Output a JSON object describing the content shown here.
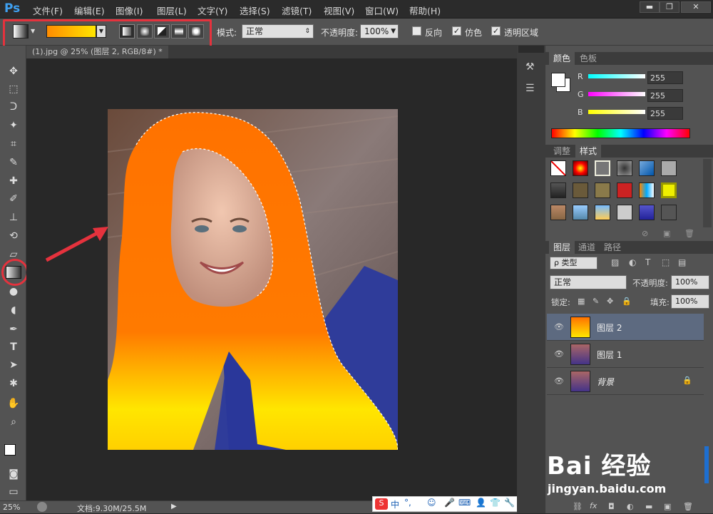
{
  "app": {
    "logo": "Ps"
  },
  "menu": [
    "文件(F)",
    "编辑(E)",
    "图像(I)",
    "图层(L)",
    "文字(Y)",
    "选择(S)",
    "滤镜(T)",
    "视图(V)",
    "窗口(W)",
    "帮助(H)"
  ],
  "window_controls": {
    "minimize": "▬",
    "restore": "❐",
    "close": "✕"
  },
  "options": {
    "mode_label": "模式:",
    "mode_value": "正常",
    "opacity_label": "不透明度:",
    "opacity_value": "100%",
    "reverse_label": "反向",
    "dither_label": "仿色",
    "transparency_label": "透明区域"
  },
  "document_tab": {
    "title": "(1).jpg @ 25% (图层 2, RGB/8#) *"
  },
  "status": {
    "zoom": "25%",
    "doc_info": "文档:9.30M/25.5M"
  },
  "color_panel": {
    "tabs": [
      "颜色",
      "色板"
    ],
    "channels": [
      {
        "label": "R",
        "value": "255",
        "color": "#00ffff"
      },
      {
        "label": "G",
        "value": "255",
        "color": "#ff00ff"
      },
      {
        "label": "B",
        "value": "255",
        "color": "#ffff00"
      }
    ]
  },
  "styles_panel": {
    "tabs": [
      "调整",
      "样式"
    ]
  },
  "layers_panel": {
    "tabs": [
      "图层",
      "通道",
      "路径"
    ],
    "filter_label": "ρ 类型",
    "blend_mode": "正常",
    "opacity_label": "不透明度:",
    "opacity_value": "100%",
    "lock_label": "锁定:",
    "fill_label": "填充:",
    "fill_value": "100%",
    "layers": [
      {
        "name": "图层 2",
        "selected": true
      },
      {
        "name": "图层 1",
        "selected": false
      },
      {
        "name": "背景",
        "selected": false,
        "locked": true
      }
    ]
  },
  "taskbar_ime": {
    "label": "中"
  },
  "watermark": {
    "brand": "Bai 经验",
    "url": "jingyan.baidu.com"
  }
}
